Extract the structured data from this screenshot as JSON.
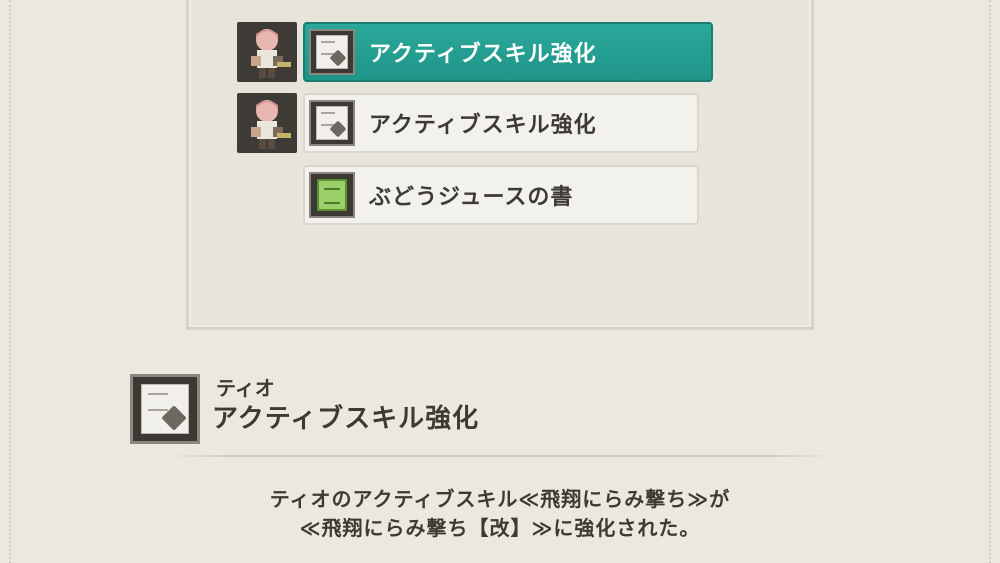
{
  "items": [
    {
      "label": "アクティブスキル強化",
      "icon": "skill-scroll-icon",
      "has_portrait": true,
      "selected": true
    },
    {
      "label": "アクティブスキル強化",
      "icon": "skill-scroll-icon",
      "has_portrait": true,
      "selected": false
    },
    {
      "label": "ぶどうジュースの書",
      "icon": "green-book-icon",
      "has_portrait": false,
      "selected": false
    }
  ],
  "detail": {
    "owner": "ティオ",
    "name": "アクティブスキル強化",
    "icon": "skill-scroll-icon",
    "description_line1": "ティオのアクティブスキル≪飛翔にらみ撃ち≫が",
    "description_line2": "≪飛翔にらみ撃ち【改】≫に強化された。"
  },
  "colors": {
    "selected_bg": "#22a193",
    "background": "#ebe8e0",
    "text": "#3d3a34"
  }
}
